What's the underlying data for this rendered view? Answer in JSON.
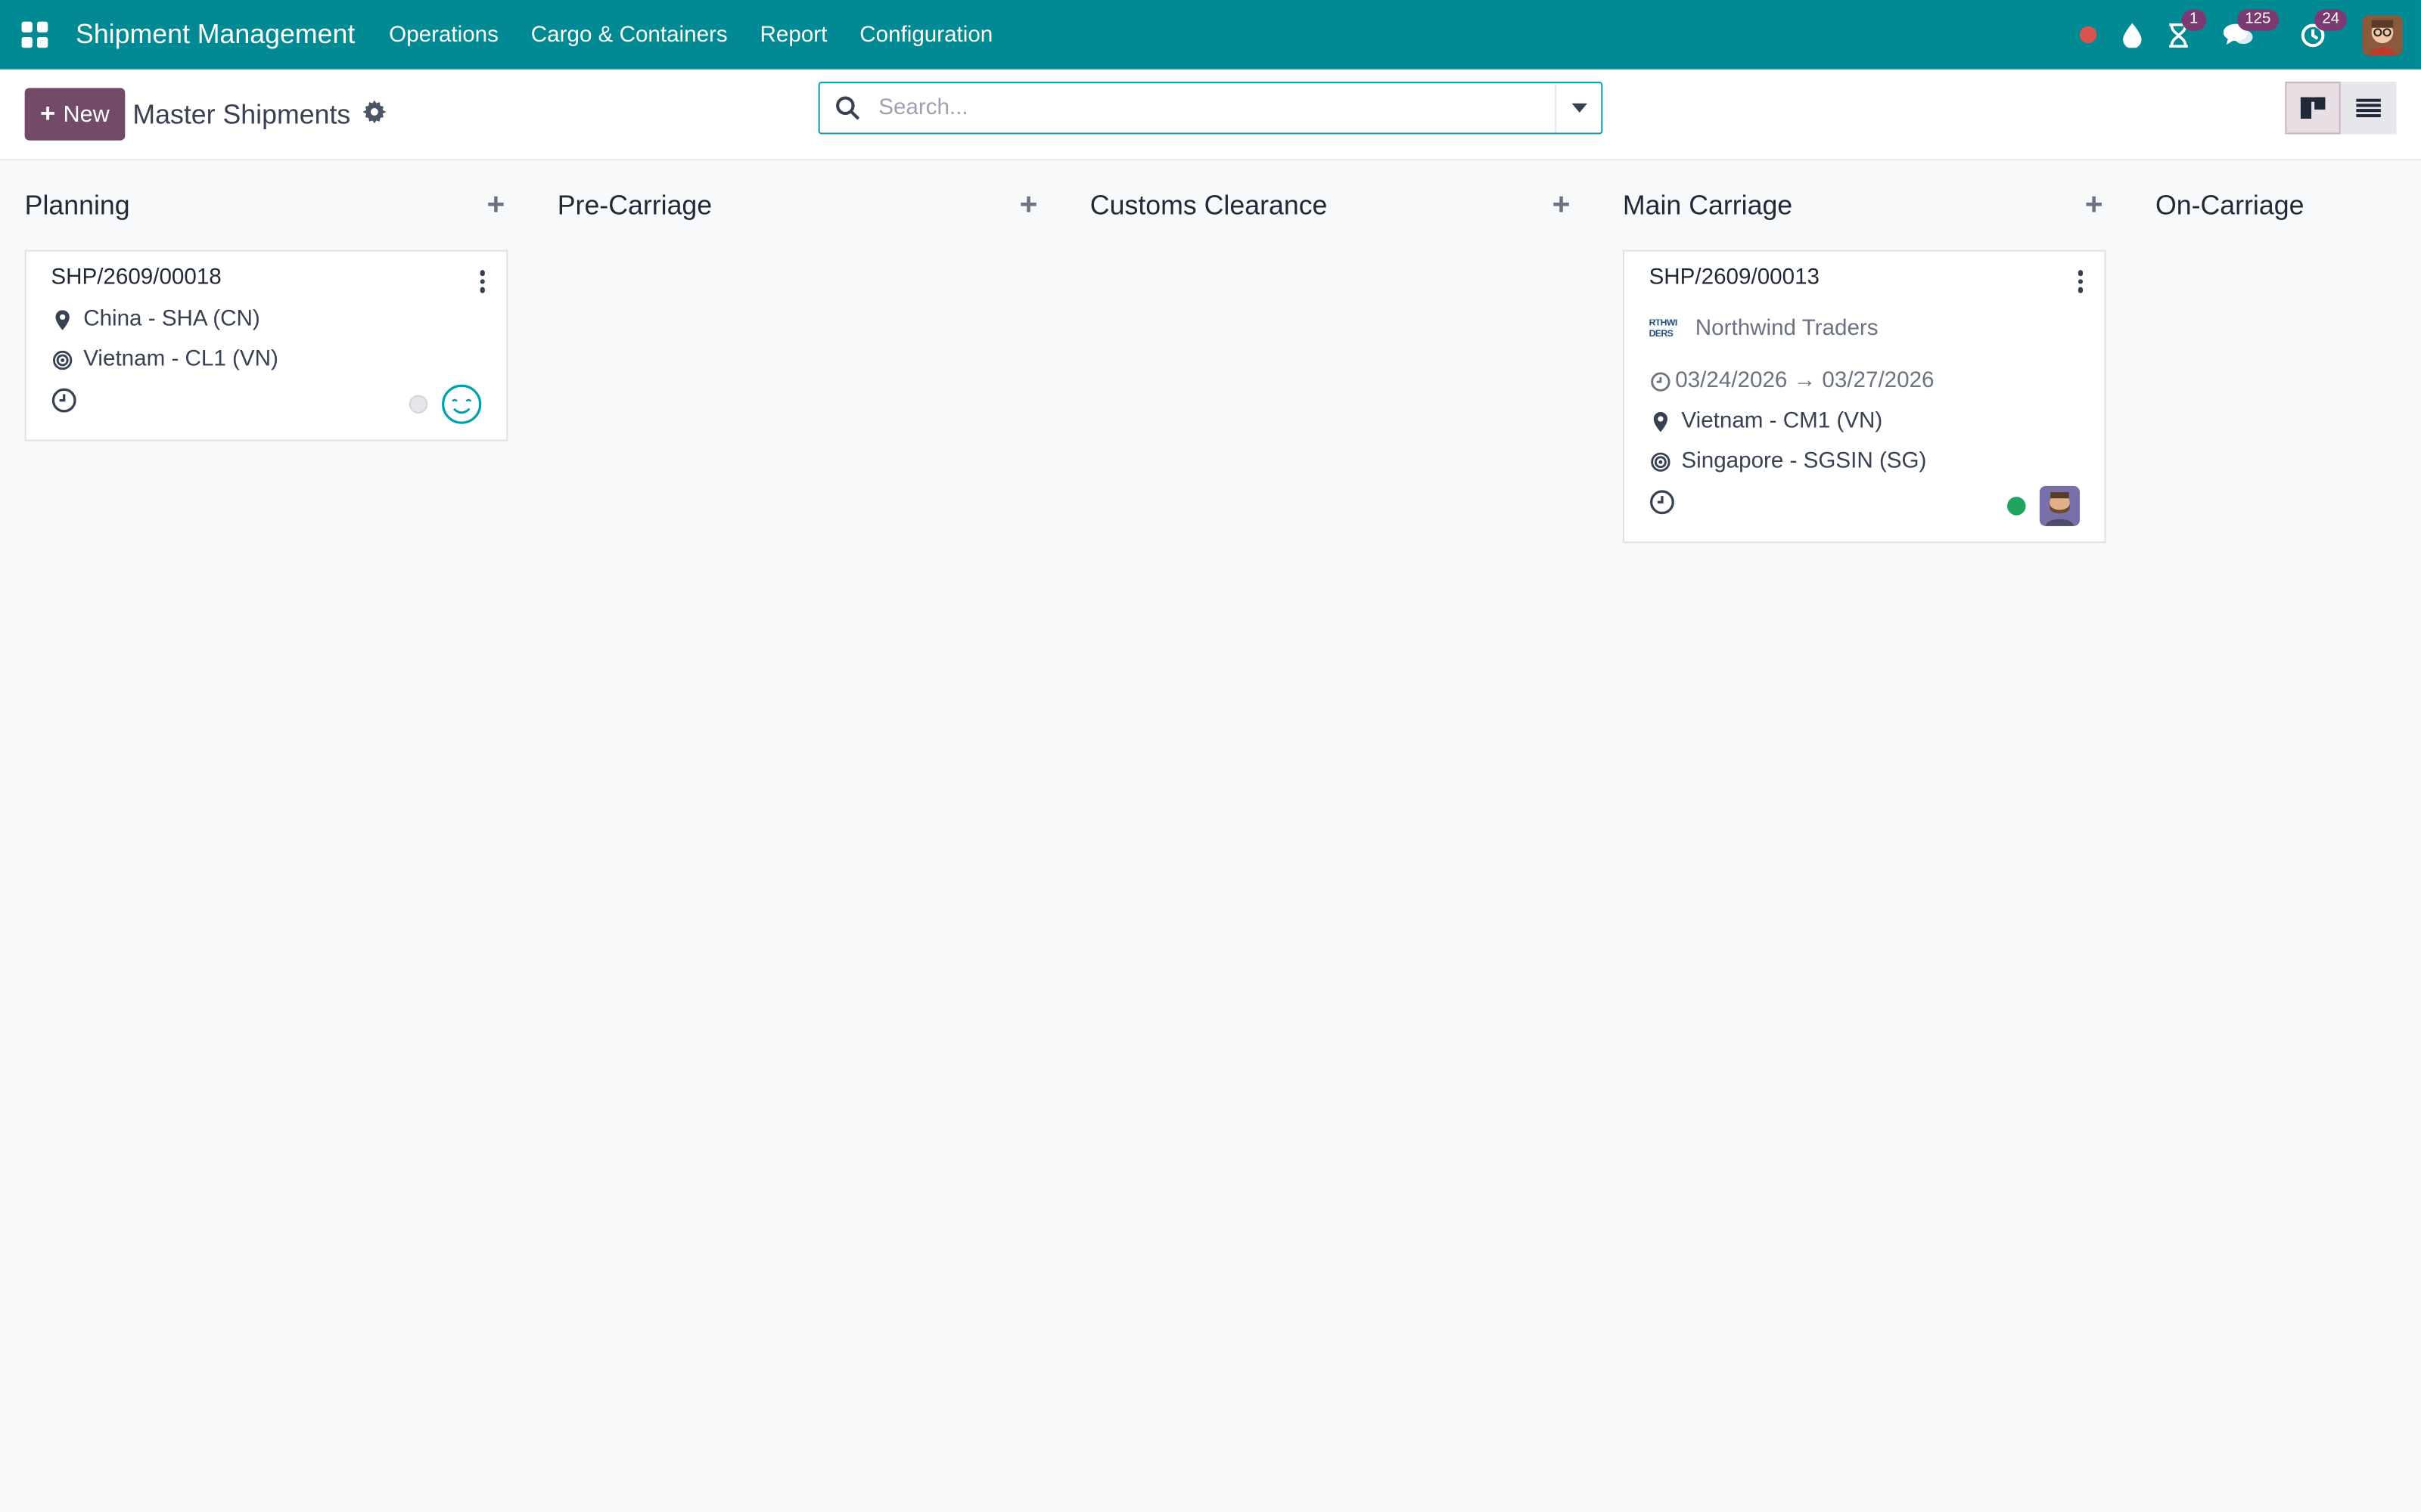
{
  "navbar": {
    "app_title": "Shipment Management",
    "menu": [
      "Operations",
      "Cargo & Containers",
      "Report",
      "Configuration"
    ],
    "badges": {
      "activities": "1",
      "messages": "125",
      "updates": "24"
    }
  },
  "control": {
    "new_label": "New",
    "page_title": "Master Shipments",
    "search_placeholder": "Search..."
  },
  "columns": [
    {
      "title": "Planning"
    },
    {
      "title": "Pre-Carriage"
    },
    {
      "title": "Customs Clearance"
    },
    {
      "title": "Main Carriage"
    },
    {
      "title": "On-Carriage"
    }
  ],
  "cards": {
    "planning": {
      "ref": "SHP/2609/00018",
      "origin": "China - SHA (CN)",
      "destination": "Vietnam - CL1 (VN)"
    },
    "main_carriage": {
      "ref": "SHP/2609/00013",
      "partner_logo_text": "RTHWI\nDERS",
      "partner": "Northwind Traders",
      "dates": "03/24/2026 → 03/27/2026",
      "origin": "Vietnam - CM1 (VN)",
      "destination": "Singapore - SGSIN (SG)"
    }
  },
  "colors": {
    "navbar": "#018a94",
    "primary": "#714b67",
    "search_border": "#01a0ab",
    "badge": "#7c3a72",
    "status_green": "#1fa35f"
  }
}
